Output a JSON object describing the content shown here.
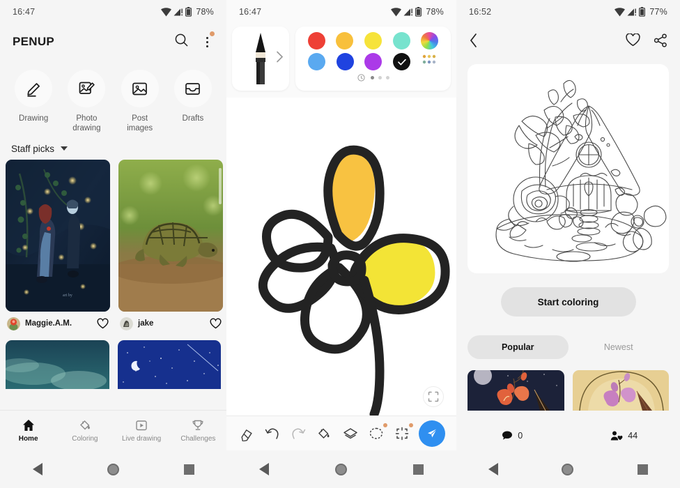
{
  "panel1": {
    "status": {
      "time": "16:47",
      "battery": "78%",
      "wifi_icon": "wifi-icon",
      "signal_icon": "signal-icon",
      "battery_icon": "battery-icon"
    },
    "header": {
      "brand": "PENUP",
      "search_icon": "search-icon",
      "more_icon": "more-vertical-icon"
    },
    "quick_actions": [
      {
        "label": "Drawing",
        "icon": "pencil-icon"
      },
      {
        "label": "Photo\ndrawing",
        "icon": "photo-edit-icon"
      },
      {
        "label": "Post\nimages",
        "icon": "image-icon"
      },
      {
        "label": "Drafts",
        "icon": "drafts-tray-icon"
      }
    ],
    "section": {
      "title": "Staff picks",
      "caret_icon": "chevron-down-icon"
    },
    "cards": [
      {
        "user": "Maggie.A.M.",
        "like_icon": "heart-outline-icon",
        "art": "night-couple-fireflies"
      },
      {
        "user": "jake",
        "like_icon": "heart-outline-icon",
        "art": "tortoise-photo"
      }
    ],
    "cards_row2": [
      {
        "art": "teal-nebula-sky"
      },
      {
        "art": "blue-starry-night"
      }
    ],
    "nav": [
      {
        "label": "Home",
        "icon": "home-icon",
        "active": true
      },
      {
        "label": "Coloring",
        "icon": "paint-bucket-icon",
        "active": false
      },
      {
        "label": "Live drawing",
        "icon": "play-box-icon",
        "active": false
      },
      {
        "label": "Challenges",
        "icon": "trophy-icon",
        "active": false
      }
    ]
  },
  "panel2": {
    "status": {
      "time": "16:47",
      "battery": "78%"
    },
    "pen": {
      "icon": "brush-pen-icon",
      "chevron_icon": "chevron-right-icon"
    },
    "palette": {
      "row1": [
        "#ee4036",
        "#f8c03c",
        "#f6e33a",
        "#77e3ce",
        "gradient-wheel"
      ],
      "row2": [
        "#5aa9f0",
        "#1f43e0",
        "#ab3ae8",
        "#111111",
        "recent-grid"
      ],
      "selected_index": 8,
      "check_icon": "check-icon",
      "history_icon": "history-clock-icon",
      "pages": 4,
      "page_active": 1
    },
    "canvas": {
      "artwork": "three-petal-flower",
      "petal_colors": [
        "#f8c241",
        "#f3e436"
      ],
      "stroke_color": "#232323",
      "expand_icon": "expand-fullscreen-icon"
    },
    "tools": [
      {
        "name": "eraser-icon",
        "badge": false
      },
      {
        "name": "undo-icon",
        "badge": false
      },
      {
        "name": "redo-icon",
        "badge": false
      },
      {
        "name": "fill-bucket-icon",
        "badge": false
      },
      {
        "name": "layers-icon",
        "badge": false
      },
      {
        "name": "lasso-select-icon",
        "badge": true
      },
      {
        "name": "transform-icon",
        "badge": true
      }
    ],
    "send": {
      "icon": "send-paper-plane-icon",
      "color": "#2f8ff0"
    }
  },
  "panel3": {
    "status": {
      "time": "16:52",
      "battery": "77%"
    },
    "header": {
      "back_icon": "chevron-left-icon",
      "like_icon": "heart-outline-icon",
      "share_icon": "share-icon"
    },
    "artwork": {
      "name": "fairy-house-magnolia-lineart"
    },
    "start_button": "Start coloring",
    "tabs": [
      {
        "label": "Popular",
        "active": true
      },
      {
        "label": "Newest",
        "active": false
      }
    ],
    "thumbs": [
      {
        "art": "night-magnolia-tent"
      },
      {
        "art": "gold-magnolia-tent"
      }
    ],
    "stats": [
      {
        "icon": "comment-icon",
        "value": "0"
      },
      {
        "icon": "people-heart-icon",
        "value": "44"
      }
    ]
  }
}
